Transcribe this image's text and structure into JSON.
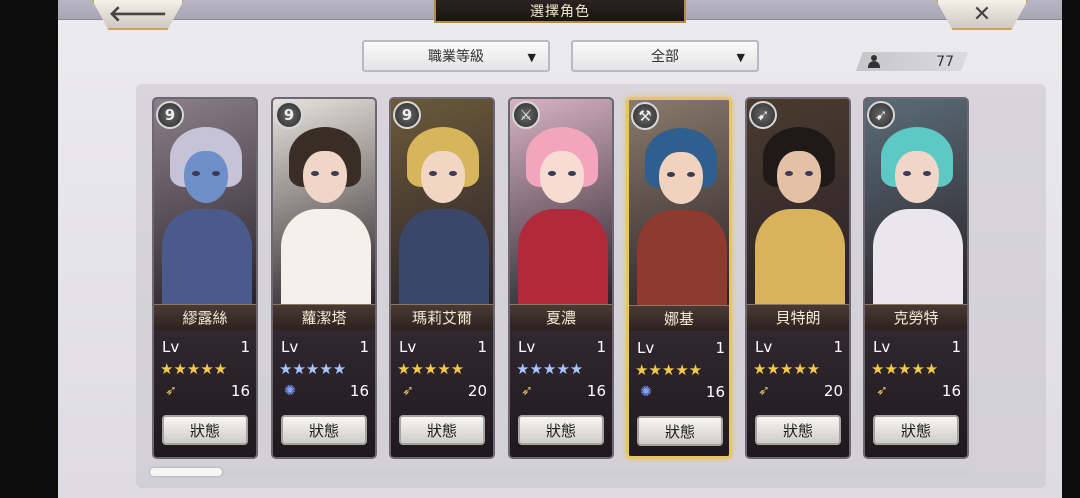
{
  "header": {
    "title": "選擇角色",
    "back_glyph": "🡐",
    "close_glyph": "✕"
  },
  "filters": {
    "class_label": "職業等級",
    "scope_label": "全部",
    "arrow": "▼"
  },
  "roster_count": "77",
  "colors": {
    "gold": "#e8c468",
    "star_gold": "#f2c94c",
    "star_blue": "#a8c4ff"
  },
  "characters": [
    {
      "name": "繆露絲",
      "lv_label": "Lv",
      "lv": "1",
      "value": "16",
      "stars": "★★★★★",
      "star_color": "gold",
      "class_icon": "sword-9-icon",
      "class_glyph": "9",
      "skill_icon": "wing-icon",
      "skill_glyph": "➶",
      "palette": {
        "bg": "#8b7f8a",
        "hair": "#c7c3d6",
        "skin": "#6f8fc9",
        "body": "#4b5a8c"
      }
    },
    {
      "name": "蘿潔塔",
      "lv_label": "Lv",
      "lv": "1",
      "value": "16",
      "stars": "★★★★★",
      "star_color": "blue",
      "class_icon": "sword-9-icon",
      "class_glyph": "9",
      "skill_icon": "swirl-icon",
      "skill_glyph": "✺",
      "palette": {
        "bg": "#e9e4dc",
        "hair": "#3a2d25",
        "skin": "#f0d6c6",
        "body": "#f4f1ea"
      }
    },
    {
      "name": "瑪莉艾爾",
      "lv_label": "Lv",
      "lv": "1",
      "value": "20",
      "stars": "★★★★★",
      "star_color": "gold",
      "class_icon": "sword-9-icon",
      "class_glyph": "9",
      "skill_icon": "wing-icon",
      "skill_glyph": "➶",
      "palette": {
        "bg": "#6b5a3a",
        "hair": "#d7b55a",
        "skin": "#f1d6c4",
        "body": "#3a4768"
      }
    },
    {
      "name": "夏濃",
      "lv_label": "Lv",
      "lv": "1",
      "value": "16",
      "stars": "★★★★★",
      "star_color": "blue",
      "class_icon": "sword-icon",
      "class_glyph": "⚔",
      "skill_icon": "wing-icon",
      "skill_glyph": "➶",
      "palette": {
        "bg": "#d8b4c4",
        "hair": "#f2a5bd",
        "skin": "#f6dcd2",
        "body": "#b02a3c"
      }
    },
    {
      "name": "娜基",
      "lv_label": "Lv",
      "lv": "1",
      "value": "16",
      "stars": "★★★★★",
      "star_color": "gold",
      "class_icon": "axe-icon",
      "class_glyph": "⚒",
      "skill_icon": "swirl-icon",
      "skill_glyph": "✺",
      "palette": {
        "bg": "#8a7a6a",
        "hair": "#2e5f8f",
        "skin": "#f1d2bf",
        "body": "#8f3a2e"
      }
    },
    {
      "name": "貝特朗",
      "lv_label": "Lv",
      "lv": "1",
      "value": "20",
      "stars": "★★★★★",
      "star_color": "gold",
      "class_icon": "bow-icon",
      "class_glyph": "➹",
      "skill_icon": "wing-icon",
      "skill_glyph": "➶",
      "palette": {
        "bg": "#4a3b2e",
        "hair": "#1f1a17",
        "skin": "#e4c1a5",
        "body": "#d9b25c"
      }
    },
    {
      "name": "克勞特",
      "lv_label": "Lv",
      "lv": "1",
      "value": "16",
      "stars": "★★★★★",
      "star_color": "gold",
      "class_icon": "bow-icon",
      "class_glyph": "➹",
      "skill_icon": "wing-icon",
      "skill_glyph": "➶",
      "palette": {
        "bg": "#5b6d78",
        "hair": "#5ec9c4",
        "skin": "#f0d6c8",
        "body": "#e9e6ee"
      }
    }
  ],
  "status_label": "狀態",
  "selected_index": 4
}
